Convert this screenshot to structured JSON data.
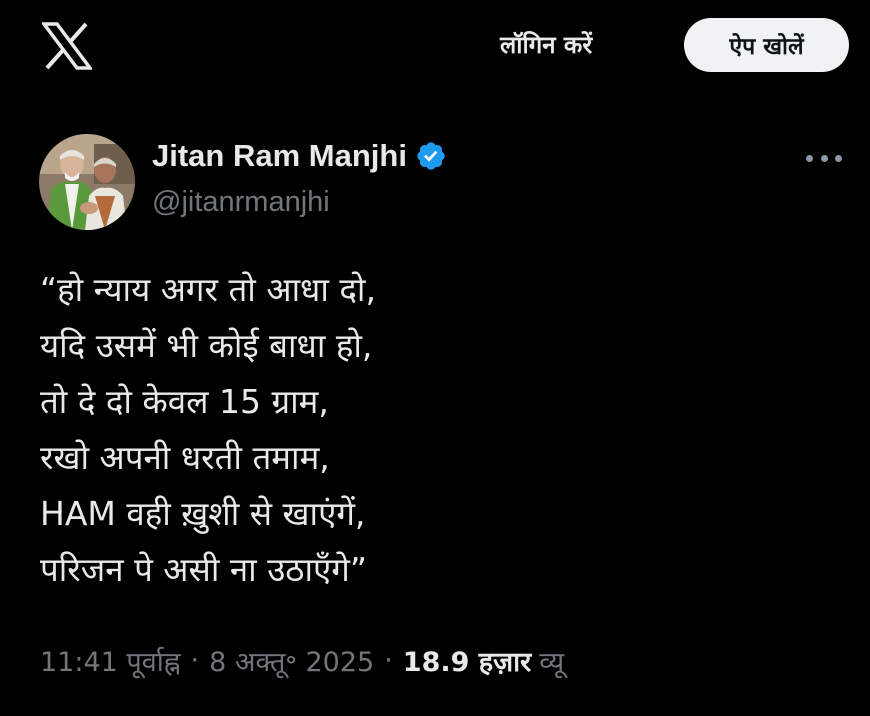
{
  "header": {
    "logo_icon": "x-logo-icon",
    "login_label": "लॉगिन करें",
    "open_app_label": "ऐप खोलें"
  },
  "tweet": {
    "author_name": "Jitan Ram Manjhi",
    "verified_icon": "verified-badge-icon",
    "verified_color": "#1d9bf0",
    "handle": "@jitanrmanjhi",
    "more_icon": "more-options-icon",
    "lines": [
      "“हो न्याय अगर तो आधा दो,",
      "यदि उसमें भी कोई बाधा हो,",
      "तो दे दो केवल 15 ग्राम,",
      "रखो अपनी धरती तमाम,",
      "HAM वही ख़ुशी से खाएंगें,",
      "परिजन पे असी ना उठाएँगे”"
    ],
    "time": "11:41 पूर्वाह्न",
    "date": "8 अक्तू॰ 2025",
    "views_count": "18.9 हज़ार",
    "views_label": "व्यू"
  }
}
